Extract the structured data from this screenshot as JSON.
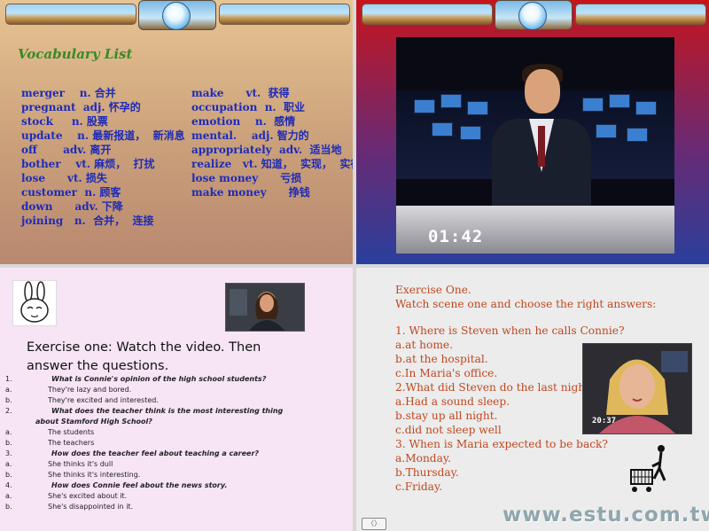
{
  "vocab": {
    "title": "Vocabulary List",
    "left": [
      "merger    n. 合并",
      "pregnant  adj. 怀孕的",
      "stock     n. 股票",
      "update    n. 最新报道，  新消息",
      "off       adv. 离开",
      "bother    vt. 麻烦，  打扰",
      "lose      vt. 损失",
      "customer  n. 顾客",
      "down      adv. 下降",
      "joining   n.  合并，  连接"
    ],
    "right": [
      "make      vt.  获得",
      "occupation  n.  职业",
      "emotion    n.  感情",
      "mental.    adj. 智力的",
      "appropriately  adv.  适当地",
      "realize   vt. 知道，  实现，  实行",
      "lose money      亏损",
      "make money      挣钱"
    ]
  },
  "video": {
    "timer": "01:42"
  },
  "exercise": {
    "title": "Exercise one: Watch the video. Then answer the questions.",
    "items": [
      {
        "n": "1.",
        "t": "What is Connie's opinion of the high school students?",
        "q": true
      },
      {
        "n": "a.",
        "t": "They're lazy and bored."
      },
      {
        "n": "b.",
        "t": "They're excited and interested."
      },
      {
        "n": "2.",
        "t": "What does the teacher think is the most interesting thing",
        "q": true
      },
      {
        "n": "",
        "t": "about Stamford High School?",
        "q": true,
        "wrap": true
      },
      {
        "n": "a.",
        "t": "The students"
      },
      {
        "n": "b.",
        "t": "The teachers"
      },
      {
        "n": "3.",
        "t": "How does the teacher feel about teaching a career?",
        "q": true
      },
      {
        "n": "a.",
        "t": "She thinks it's dull"
      },
      {
        "n": "b.",
        "t": "She thinks it's interesting."
      },
      {
        "n": "4.",
        "t": "How does Connie feel about the news story.",
        "q": true
      },
      {
        "n": "a.",
        "t": "She's excited about it."
      },
      {
        "n": "b.",
        "t": "She's disappointed in it."
      }
    ]
  },
  "exercise_one": {
    "lines": [
      "Exercise One.",
      "Watch scene one and choose the right answers:",
      "",
      "1. Where is Steven when he calls Connie?",
      "a.at home.",
      "b.at the hospital.",
      "c.In Maria's office.",
      "2.What did Steven do the last night?",
      "a.Had a sound sleep.",
      "b.stay up all night.",
      "c.did not sleep well",
      "3. When is Maria expected to be back?",
      "a.Monday.",
      "b.Thursday.",
      "c.Friday."
    ],
    "thumb_time": "20:37",
    "watermark": "www.estu.com.tw"
  },
  "colors": {
    "vocab_text": "#1d2bb8",
    "vocab_title": "#3a8a28",
    "exercise_text": "#c0471e"
  }
}
